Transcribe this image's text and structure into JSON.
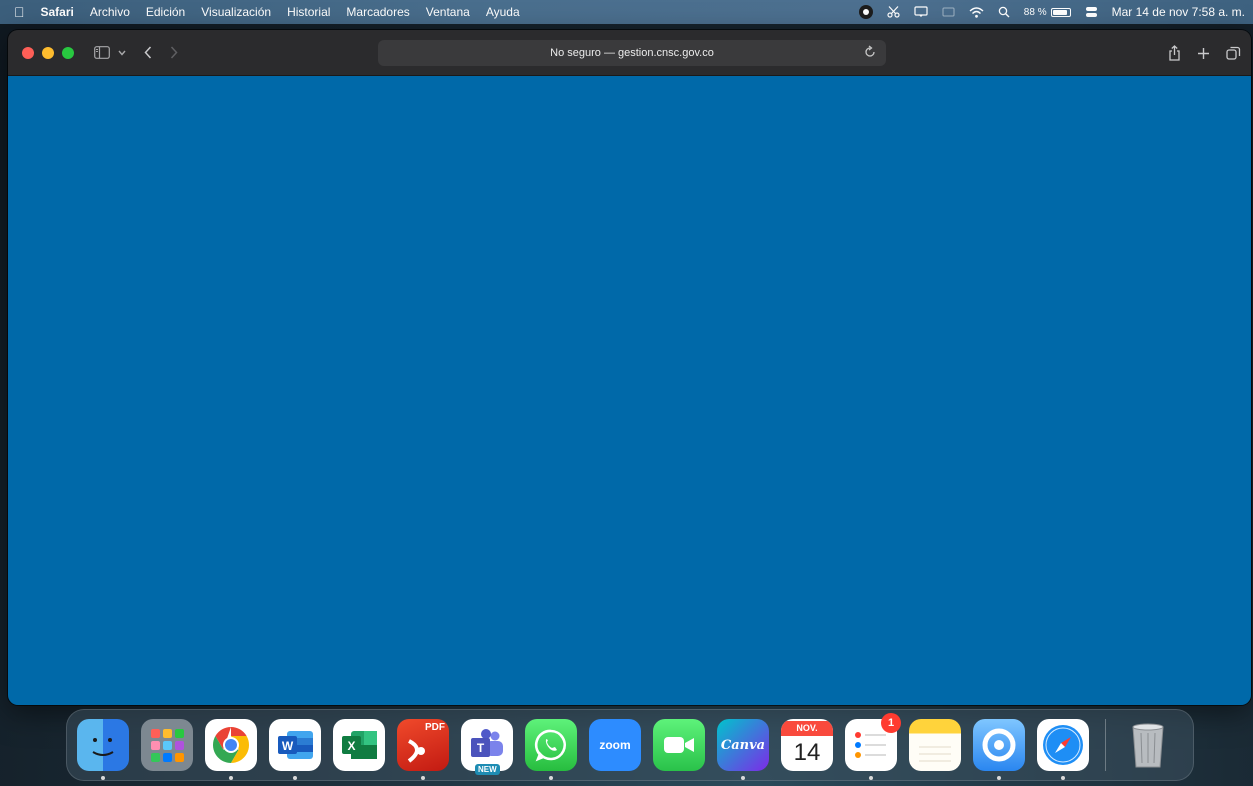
{
  "menubar": {
    "apple": "",
    "app_name": "Safari",
    "menus": [
      "Archivo",
      "Edición",
      "Visualización",
      "Historial",
      "Marcadores",
      "Ventana",
      "Ayuda"
    ],
    "battery_percent": "88 %",
    "battery_level": 0.88,
    "datetime": "Mar 14 de nov  7:58 a. m."
  },
  "browser": {
    "address": "No seguro — gestion.cnsc.gov.co",
    "content_color": "#0069a9"
  },
  "dock": {
    "items": [
      {
        "app": "Finder",
        "icon": "finder-icon",
        "running": true
      },
      {
        "app": "Launchpad",
        "icon": "launchpad-icon",
        "running": false
      },
      {
        "app": "Google Chrome",
        "icon": "chrome-icon",
        "running": true
      },
      {
        "app": "Microsoft Word",
        "icon": "word-icon",
        "running": true
      },
      {
        "app": "Microsoft Excel",
        "icon": "excel-icon",
        "running": false
      },
      {
        "app": "PDF Expert",
        "icon": "pdf-icon",
        "label": "PDF",
        "running": true
      },
      {
        "app": "Microsoft Teams",
        "icon": "teams-icon",
        "label": "NEW",
        "running": false
      },
      {
        "app": "WhatsApp",
        "icon": "whatsapp-icon",
        "running": true
      },
      {
        "app": "Zoom",
        "icon": "zoom-icon",
        "label": "zoom",
        "running": false
      },
      {
        "app": "FaceTime",
        "icon": "facetime-icon",
        "running": false
      },
      {
        "app": "Canva",
        "icon": "canva-icon",
        "label": "Canva",
        "running": true
      },
      {
        "app": "Calendar",
        "icon": "calendar-icon",
        "month": "NOV.",
        "day": "14",
        "running": false
      },
      {
        "app": "Reminders",
        "icon": "reminders-icon",
        "badge": "1",
        "running": true
      },
      {
        "app": "Notes",
        "icon": "notes-icon",
        "running": false
      },
      {
        "app": "VPN",
        "icon": "vpn-icon",
        "running": true
      },
      {
        "app": "Safari",
        "icon": "safari-icon",
        "running": true
      },
      {
        "app": "Trash",
        "icon": "trash-icon",
        "running": false
      }
    ]
  }
}
